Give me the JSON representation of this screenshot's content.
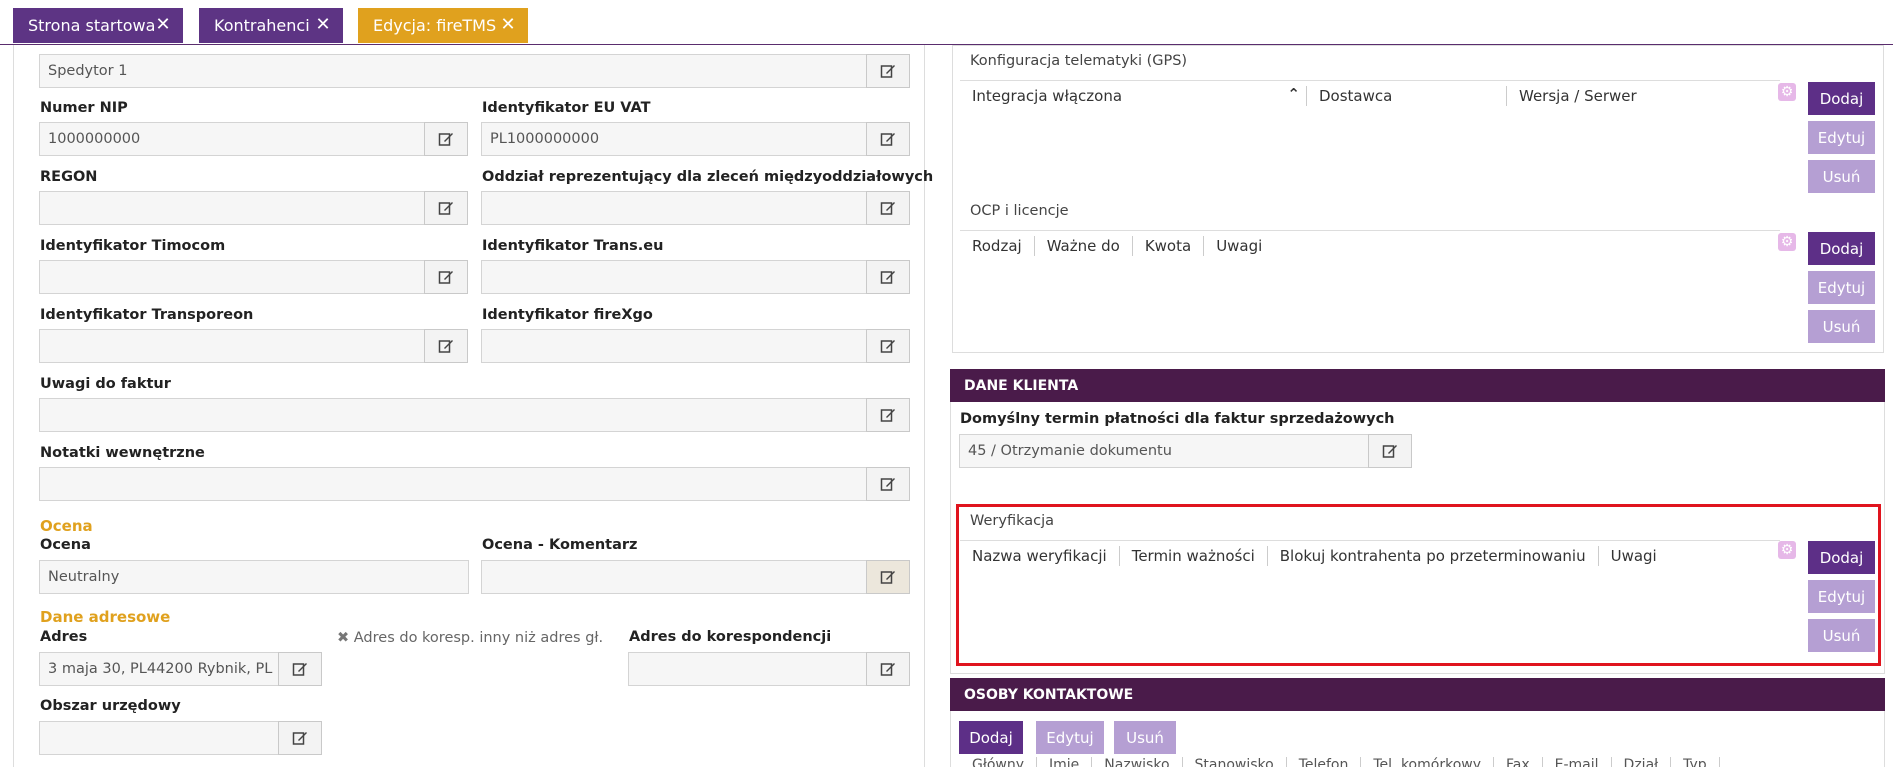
{
  "tabs": [
    {
      "label": "Strona startowa"
    },
    {
      "label": "Kontrahenci"
    },
    {
      "label": "Edycja: fireTMS"
    }
  ],
  "colors": {
    "tab_purple": "#5d3484",
    "tab_active": "#e0a11e",
    "header_dark": "#4a1b4a",
    "highlight": "#e0141e"
  },
  "left": {
    "spedytor_value": "Spedytor 1",
    "nip": {
      "label": "Numer NIP",
      "value": "1000000000"
    },
    "euvat": {
      "label": "Identyfikator EU VAT",
      "value": "PL1000000000"
    },
    "regon": {
      "label": "REGON",
      "value": ""
    },
    "oddzial": {
      "label": "Oddział reprezentujący dla zleceń międzyoddziałowych",
      "value": ""
    },
    "timocom": {
      "label": "Identyfikator Timocom",
      "value": ""
    },
    "transeu": {
      "label": "Identyfikator Trans.eu",
      "value": ""
    },
    "transporeon": {
      "label": "Identyfikator Transporeon",
      "value": ""
    },
    "firexgo": {
      "label": "Identyfikator fireXgo",
      "value": ""
    },
    "uwagi_faktur": {
      "label": "Uwagi do faktur",
      "value": ""
    },
    "notatki": {
      "label": "Notatki wewnętrzne",
      "value": ""
    },
    "ocena_section": "Ocena",
    "ocena": {
      "label": "Ocena",
      "value": "Neutralny"
    },
    "ocena_komentarz": {
      "label": "Ocena - Komentarz",
      "value": ""
    },
    "adres_section": "Dane adresowe",
    "adres": {
      "label": "Adres",
      "value": "3 maja 30, PL44200 Rybnik, PL"
    },
    "adres_koresp_checkbox": "Adres do koresp. inny niż adres gł.",
    "adres_koresp": {
      "label": "Adres do korespondencji",
      "value": ""
    },
    "obszar": {
      "label": "Obszar urzędowy",
      "value": ""
    }
  },
  "right": {
    "gps": {
      "title": "Konfiguracja telematyki (GPS)",
      "columns": [
        "Integracja włączona",
        "Dostawca",
        "Wersja / Serwer"
      ]
    },
    "ocp": {
      "title": "OCP i licencje",
      "columns": [
        "Rodzaj",
        "Ważne do",
        "Kwota",
        "Uwagi"
      ]
    },
    "dane_klienta": {
      "header": "DANE KLIENTA",
      "termin_label": "Domyślny termin płatności dla faktur sprzedażowych",
      "termin_value": "45 / Otrzymanie dokumentu"
    },
    "weryfikacja": {
      "title": "Weryfikacja",
      "columns": [
        "Nazwa weryfikacji",
        "Termin ważności",
        "Blokuj kontrahenta po przeterminowaniu",
        "Uwagi"
      ]
    },
    "osoby": {
      "header": "OSOBY KONTAKTOWE",
      "columns": [
        "Główny",
        "Imię",
        "Nazwisko",
        "Stanowisko",
        "Telefon",
        "Tel. komórkowy",
        "Fax",
        "E-mail",
        "Dział",
        "Typ"
      ]
    },
    "buttons": {
      "add": "Dodaj",
      "edit": "Edytuj",
      "delete": "Usuń"
    }
  }
}
